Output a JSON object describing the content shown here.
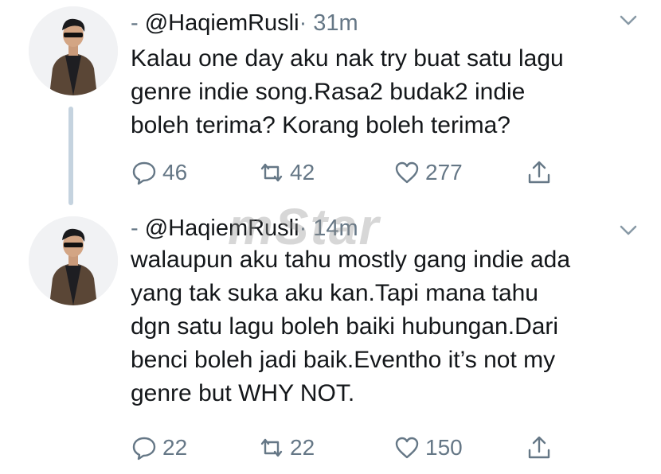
{
  "tweets": [
    {
      "separator": "-",
      "handle": "@HaqiemRusli",
      "time_sep": "·",
      "time": "31m",
      "text": "Kalau one day aku nak try buat satu lagu\ngenre indie song.Rasa2 budak2 indie\nboleh terima? Korang boleh terima?",
      "replies": "46",
      "retweets": "42",
      "likes": "277"
    },
    {
      "separator": "-",
      "handle": "@HaqiemRusli",
      "time_sep": "·",
      "time": "14m",
      "text": "walaupun aku tahu mostly gang indie ada\nyang tak suka aku kan.Tapi mana tahu\ndgn satu lagu boleh baiki hubungan.Dari\nbenci boleh jadi baik.Eventho it’s not my\ngenre but WHY NOT.",
      "replies": "22",
      "retweets": "22",
      "likes": "150"
    }
  ],
  "watermark": {
    "prefix": "mStar",
    "suffix": "Star"
  },
  "icons": {
    "reply": "reply-icon",
    "retweet": "retweet-icon",
    "like": "heart-icon",
    "share": "share-icon",
    "caret": "chevron-down-icon"
  },
  "colors": {
    "text": "#14171a",
    "muted": "#657786",
    "thread": "#c5d3df"
  }
}
